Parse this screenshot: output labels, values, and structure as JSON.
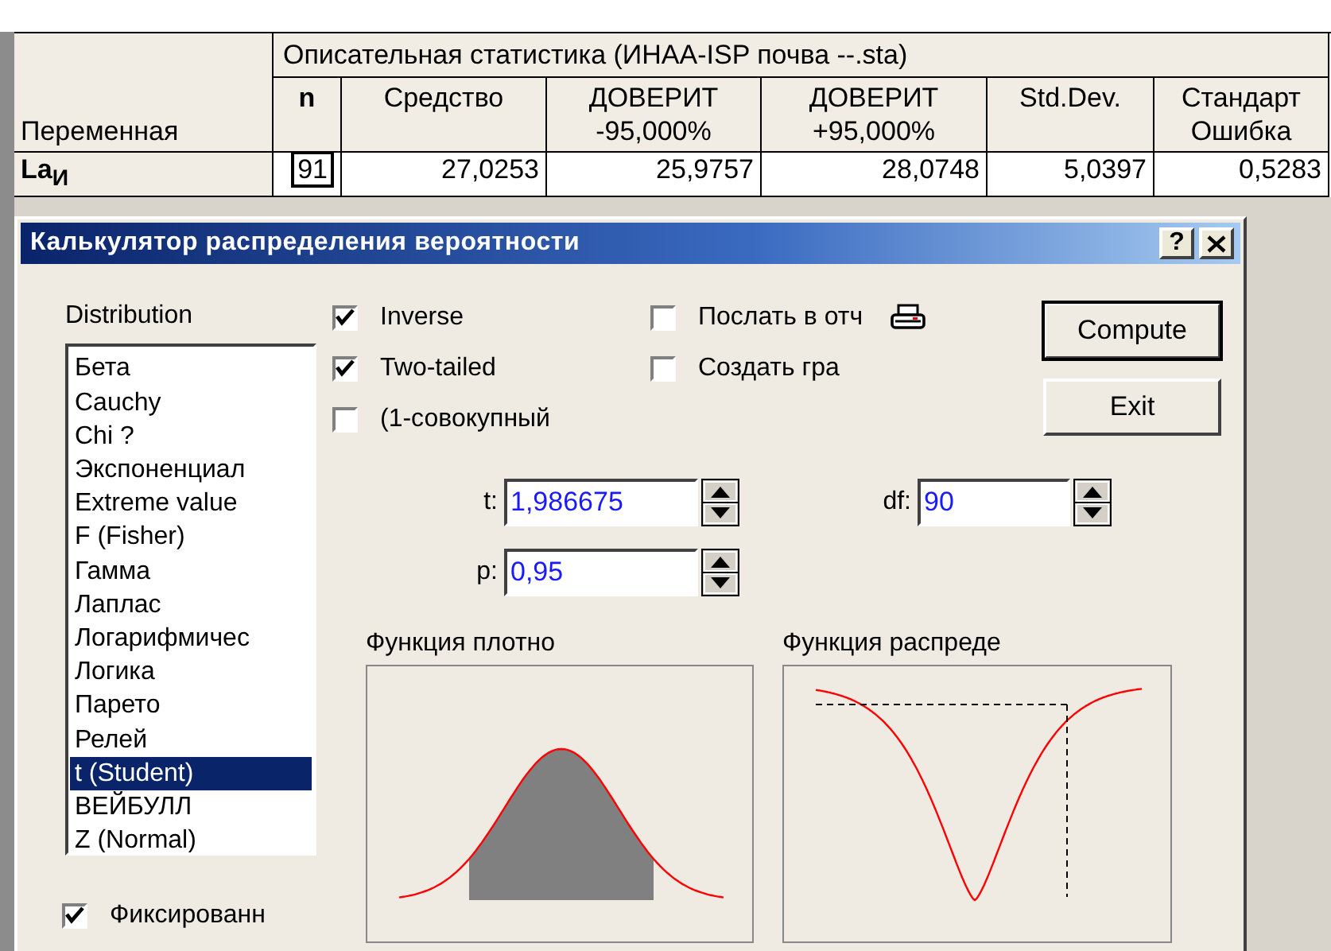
{
  "table": {
    "title": "Описательная статистика (ИНАА-ISP почва --.sta)",
    "columns": [
      {
        "lines": [
          "Переменная"
        ]
      },
      {
        "lines": [
          "n"
        ]
      },
      {
        "lines": [
          "Средство"
        ]
      },
      {
        "lines": [
          "ДОВЕРИТ",
          "-95,000%"
        ]
      },
      {
        "lines": [
          "ДОВЕРИТ",
          "+95,000%"
        ]
      },
      {
        "lines": [
          "Std.Dev."
        ]
      },
      {
        "lines": [
          "Стандарт",
          "Ошибка"
        ]
      }
    ],
    "rows": [
      {
        "cells": [
          "La$_{И}$",
          "91",
          "27,0253",
          "25,9757",
          "28,0748",
          "5,0397",
          "0,5283"
        ]
      }
    ]
  },
  "dialog": {
    "title": "Калькулятор распределения вероятности",
    "help_button": "?",
    "distribution": {
      "label": "Distribution",
      "items": [
        {
          "label": "Бета",
          "selected": false
        },
        {
          "label": "Cauchy",
          "selected": false
        },
        {
          "label": "Chi ?",
          "selected": false
        },
        {
          "label": "Экспоненциал",
          "selected": false
        },
        {
          "label": "Extreme value",
          "selected": false
        },
        {
          "label": "F (Fisher)",
          "selected": false
        },
        {
          "label": "Гамма",
          "selected": false
        },
        {
          "label": "Лаплас",
          "selected": false
        },
        {
          "label": "Логарифмичес",
          "selected": false
        },
        {
          "label": "Логика",
          "selected": false
        },
        {
          "label": "Парето",
          "selected": false
        },
        {
          "label": "Релей",
          "selected": false
        },
        {
          "label": "t (Student)",
          "selected": true
        },
        {
          "label": "ВЕЙБУЛЛ",
          "selected": false
        },
        {
          "label": "Z (Normal)",
          "selected": false
        }
      ]
    },
    "fixed": {
      "label": "Фиксированн",
      "checked": true
    },
    "options_left": [
      {
        "label": "Inverse",
        "checked": true
      },
      {
        "label": "Two-tailed",
        "checked": true
      },
      {
        "label": "(1-совокупный",
        "checked": false
      }
    ],
    "options_right": [
      {
        "label": "Послать в отч",
        "checked": false
      },
      {
        "label": "Создать гра",
        "checked": false
      }
    ],
    "fields": [
      {
        "label": "t:",
        "value": "1,986675"
      },
      {
        "label": "df:",
        "value": "90"
      },
      {
        "label": "p:",
        "value": "0,95"
      }
    ],
    "buttons": [
      {
        "label": "Compute",
        "default": true
      },
      {
        "label": "Exit",
        "default": false
      }
    ],
    "plots": [
      {
        "title": "Функция плотно",
        "kind": "density"
      },
      {
        "title": "Функция распреде",
        "kind": "cdf"
      }
    ]
  }
}
